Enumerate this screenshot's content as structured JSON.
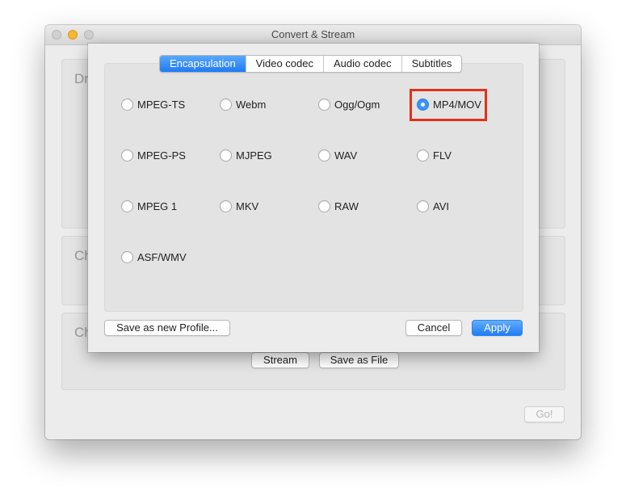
{
  "window": {
    "title": "Convert & Stream"
  },
  "background": {
    "panels": [
      {
        "label": "Dr"
      },
      {
        "label": "Ch"
      },
      {
        "label": "Ch"
      }
    ],
    "stream_button": "Stream",
    "save_as_file_button": "Save as File",
    "go_button": "Go!"
  },
  "sheet": {
    "tabs": [
      {
        "label": "Encapsulation",
        "active": true
      },
      {
        "label": "Video codec",
        "active": false
      },
      {
        "label": "Audio codec",
        "active": false
      },
      {
        "label": "Subtitles",
        "active": false
      }
    ],
    "options": [
      {
        "label": "MPEG-TS",
        "checked": false
      },
      {
        "label": "Webm",
        "checked": false
      },
      {
        "label": "Ogg/Ogm",
        "checked": false
      },
      {
        "label": "MP4/MOV",
        "checked": true
      },
      {
        "label": "MPEG-PS",
        "checked": false
      },
      {
        "label": "MJPEG",
        "checked": false
      },
      {
        "label": "WAV",
        "checked": false
      },
      {
        "label": "FLV",
        "checked": false
      },
      {
        "label": "MPEG 1",
        "checked": false
      },
      {
        "label": "MKV",
        "checked": false
      },
      {
        "label": "RAW",
        "checked": false
      },
      {
        "label": "AVI",
        "checked": false
      },
      {
        "label": "ASF/WMV",
        "checked": false
      }
    ],
    "save_profile_button": "Save as new Profile...",
    "cancel_button": "Cancel",
    "apply_button": "Apply"
  },
  "colors": {
    "accent": "#217cf5",
    "highlight": "#e0321a"
  }
}
